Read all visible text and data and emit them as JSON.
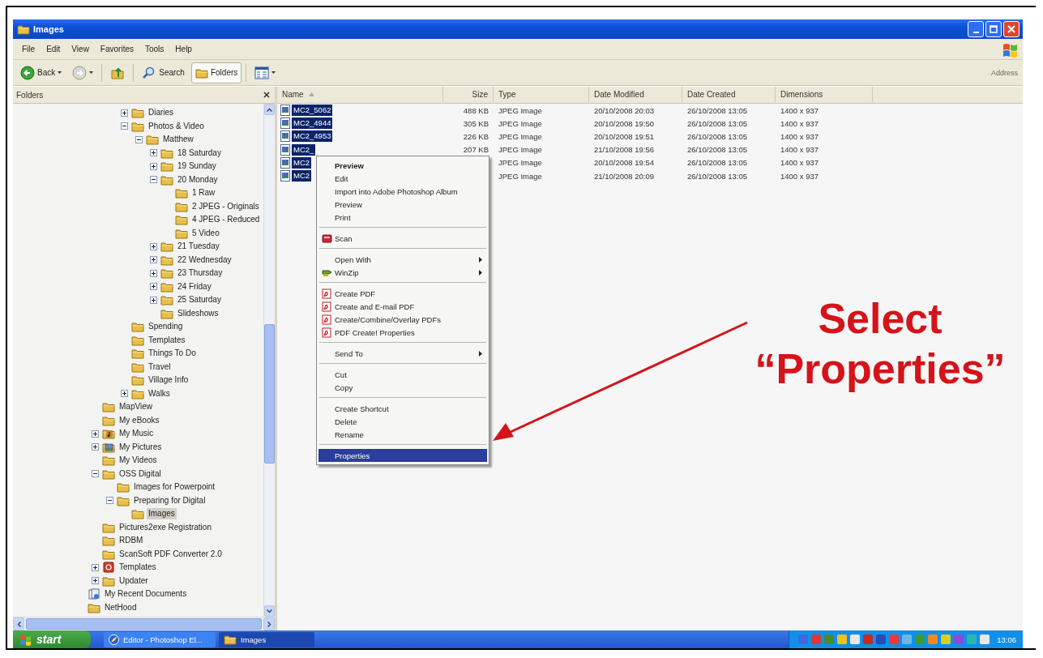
{
  "window": {
    "title": "Images"
  },
  "menu_bar": [
    "File",
    "Edit",
    "View",
    "Favorites",
    "Tools",
    "Help"
  ],
  "toolbar": {
    "buttons": [
      {
        "kind": "back",
        "label": "Back",
        "pressed": false
      },
      {
        "kind": "forward",
        "pressed": false
      },
      {
        "kind": "up",
        "pressed": false
      },
      {
        "kind": "search",
        "label": "Search",
        "pressed": false
      },
      {
        "kind": "folders",
        "label": "Folders",
        "pressed": true
      },
      {
        "kind": "views",
        "pressed": false
      }
    ],
    "address_label": "Address"
  },
  "folders_pane": {
    "title": "Folders",
    "tree": [
      {
        "children": [
          {
            "children": [
              {
                "children": [
                  {
                    "label": "Diaries",
                    "kind": "folder",
                    "expanded": false,
                    "selected": false
                  },
                  {
                    "label": "Photos & Video",
                    "kind": "folder",
                    "expanded": true,
                    "selected": false,
                    "children": [
                      {
                        "label": "Matthew",
                        "kind": "folder",
                        "expanded": true,
                        "selected": false,
                        "children": [
                          {
                            "label": "18 Saturday",
                            "kind": "folder",
                            "expanded": false,
                            "selected": false
                          },
                          {
                            "label": "19 Sunday",
                            "kind": "folder",
                            "expanded": false,
                            "selected": false
                          },
                          {
                            "label": "20 Monday",
                            "kind": "folder",
                            "expanded": true,
                            "selected": false,
                            "children": [
                              {
                                "label": "1 Raw",
                                "kind": "folder",
                                "selected": false
                              },
                              {
                                "label": "2 JPEG - Originals",
                                "kind": "folder",
                                "selected": false
                              },
                              {
                                "label": "4 JPEG - Reduced",
                                "kind": "folder",
                                "selected": false
                              },
                              {
                                "label": "5 Video",
                                "kind": "folder",
                                "selected": false
                              }
                            ]
                          },
                          {
                            "label": "21 Tuesday",
                            "kind": "folder",
                            "expanded": false,
                            "selected": false
                          },
                          {
                            "label": "22 Wednesday",
                            "kind": "folder",
                            "expanded": false,
                            "selected": false
                          },
                          {
                            "label": "23 Thursday",
                            "kind": "folder",
                            "expanded": false,
                            "selected": false
                          },
                          {
                            "label": "24 Friday",
                            "kind": "folder",
                            "expanded": false,
                            "selected": false
                          },
                          {
                            "label": "25 Saturday",
                            "kind": "folder",
                            "expanded": false,
                            "selected": false
                          },
                          {
                            "label": "Slideshows",
                            "kind": "folder",
                            "selected": false
                          }
                        ]
                      }
                    ]
                  },
                  {
                    "label": "Spending",
                    "kind": "folder",
                    "selected": false
                  },
                  {
                    "label": "Templates",
                    "kind": "folder",
                    "selected": false
                  },
                  {
                    "label": "Things To Do",
                    "kind": "folder",
                    "selected": false
                  },
                  {
                    "label": "Travel",
                    "kind": "folder",
                    "selected": false
                  },
                  {
                    "label": "Village Info",
                    "kind": "folder",
                    "selected": false
                  },
                  {
                    "label": "Walks",
                    "kind": "folder",
                    "expanded": false,
                    "selected": false
                  }
                ]
              }
            ]
          },
          {
            "label": "MapView",
            "kind": "folder",
            "selected": false
          },
          {
            "label": "My eBooks",
            "kind": "folder",
            "selected": false
          },
          {
            "label": "My Music",
            "kind": "music",
            "expanded": false,
            "selected": false
          },
          {
            "label": "My Pictures",
            "kind": "pictures",
            "expanded": false,
            "selected": false
          },
          {
            "label": "My Videos",
            "kind": "folder",
            "selected": false
          },
          {
            "label": "OSS Digital",
            "kind": "folder",
            "expanded": true,
            "selected": false,
            "children": [
              {
                "label": "Images for Powerpoint",
                "kind": "folder",
                "selected": false
              },
              {
                "label": "Preparing for Digital",
                "kind": "folder",
                "expanded": true,
                "selected": false,
                "children": [
                  {
                    "label": "Images",
                    "kind": "folder",
                    "selected": true
                  }
                ]
              }
            ]
          },
          {
            "label": "Pictures2exe Registration",
            "kind": "folder",
            "selected": false
          },
          {
            "label": "RDBM",
            "kind": "folder",
            "selected": false
          },
          {
            "label": "ScanSoft PDF Converter 2.0",
            "kind": "folder",
            "selected": false
          },
          {
            "label": "Templates",
            "kind": "templates",
            "expanded": false,
            "selected": false
          },
          {
            "label": "Updater",
            "kind": "folder",
            "expanded": false,
            "selected": false
          }
        ]
      },
      {
        "label": "My Recent Documents",
        "kind": "recent",
        "selected": false
      },
      {
        "label": "NetHood",
        "kind": "folder",
        "selected": false
      }
    ]
  },
  "file_list": {
    "columns": [
      "Name",
      "Size",
      "Type",
      "Date Modified",
      "Date Created",
      "Dimensions"
    ],
    "rows": [
      {
        "name": "MC2_5062",
        "size": "488 KB",
        "type": "JPEG Image",
        "date_modified": "20/10/2008 20:03",
        "date_created": "26/10/2008 13:05",
        "dimensions": "1400 x 937",
        "selected": true
      },
      {
        "name": "MC2_4944",
        "size": "305 KB",
        "type": "JPEG Image",
        "date_modified": "20/10/2008 19:50",
        "date_created": "26/10/2008 13:05",
        "dimensions": "1400 x 937",
        "selected": true
      },
      {
        "name": "MC2_4953",
        "size": "226 KB",
        "type": "JPEG Image",
        "date_modified": "20/10/2008 19:51",
        "date_created": "26/10/2008 13:05",
        "dimensions": "1400 x 937",
        "selected": true
      },
      {
        "name": "MC2_",
        "size": "207 KB",
        "type": "JPEG Image",
        "date_modified": "21/10/2008 19:56",
        "date_created": "26/10/2008 13:05",
        "dimensions": "1400 x 937",
        "selected": true
      },
      {
        "name": "MC2",
        "type": "JPEG Image",
        "date_modified": "20/10/2008 19:54",
        "date_created": "26/10/2008 13:05",
        "dimensions": "1400 x 937",
        "selected": true
      },
      {
        "name": "MC2",
        "type": "JPEG Image",
        "date_modified": "21/10/2008 20:09",
        "date_created": "26/10/2008 13:05",
        "dimensions": "1400 x 937",
        "selected": true
      }
    ]
  },
  "context_menu": {
    "items": [
      {
        "kind": "item",
        "label": "Preview",
        "default": true,
        "submenu": false,
        "selected": false
      },
      {
        "kind": "item",
        "label": "Edit",
        "default": false,
        "submenu": false,
        "selected": false
      },
      {
        "kind": "item",
        "label": "Import into Adobe Photoshop Album",
        "default": false,
        "submenu": false,
        "selected": false
      },
      {
        "kind": "item",
        "label": "Preview",
        "default": false,
        "submenu": false,
        "selected": false
      },
      {
        "kind": "item",
        "label": "Print",
        "default": false,
        "submenu": false,
        "selected": false
      },
      {
        "kind": "separator"
      },
      {
        "kind": "scan",
        "label": "Scan",
        "default": false,
        "submenu": false,
        "selected": false
      },
      {
        "kind": "separator"
      },
      {
        "kind": "item",
        "label": "Open With",
        "default": false,
        "submenu": true,
        "selected": false
      },
      {
        "kind": "winzip",
        "label": "WinZip",
        "default": false,
        "submenu": true,
        "selected": false
      },
      {
        "kind": "separator"
      },
      {
        "kind": "pdf",
        "label": "Create PDF",
        "default": false,
        "submenu": false,
        "selected": false
      },
      {
        "kind": "pdf",
        "label": "Create and E-mail PDF",
        "default": false,
        "submenu": false,
        "selected": false
      },
      {
        "kind": "pdf",
        "label": "Create/Combine/Overlay PDFs",
        "default": false,
        "submenu": false,
        "selected": false
      },
      {
        "kind": "pdf",
        "label": "PDF Create! Properties",
        "default": false,
        "submenu": false,
        "selected": false
      },
      {
        "kind": "separator"
      },
      {
        "kind": "item",
        "label": "Send To",
        "default": false,
        "submenu": true,
        "selected": false
      },
      {
        "kind": "separator"
      },
      {
        "kind": "item",
        "label": "Cut",
        "default": false,
        "submenu": false,
        "selected": false
      },
      {
        "kind": "item",
        "label": "Copy",
        "default": false,
        "submenu": false,
        "selected": false
      },
      {
        "kind": "separator"
      },
      {
        "kind": "item",
        "label": "Create Shortcut",
        "default": false,
        "submenu": false,
        "selected": false
      },
      {
        "kind": "item",
        "label": "Delete",
        "default": false,
        "submenu": false,
        "selected": false
      },
      {
        "kind": "item",
        "label": "Rename",
        "default": false,
        "submenu": false,
        "selected": false
      },
      {
        "kind": "separator"
      },
      {
        "kind": "item",
        "label": "Properties",
        "default": false,
        "submenu": false,
        "selected": true
      }
    ]
  },
  "annotation": {
    "text": "Select “Properties”"
  },
  "taskbar": {
    "start": "start",
    "tasks": [
      {
        "label": "Editor - Photoshop El...",
        "kind": "photoshop",
        "active": false
      },
      {
        "label": "Images",
        "kind": "folder",
        "active": true
      }
    ],
    "clock": "13:06"
  }
}
